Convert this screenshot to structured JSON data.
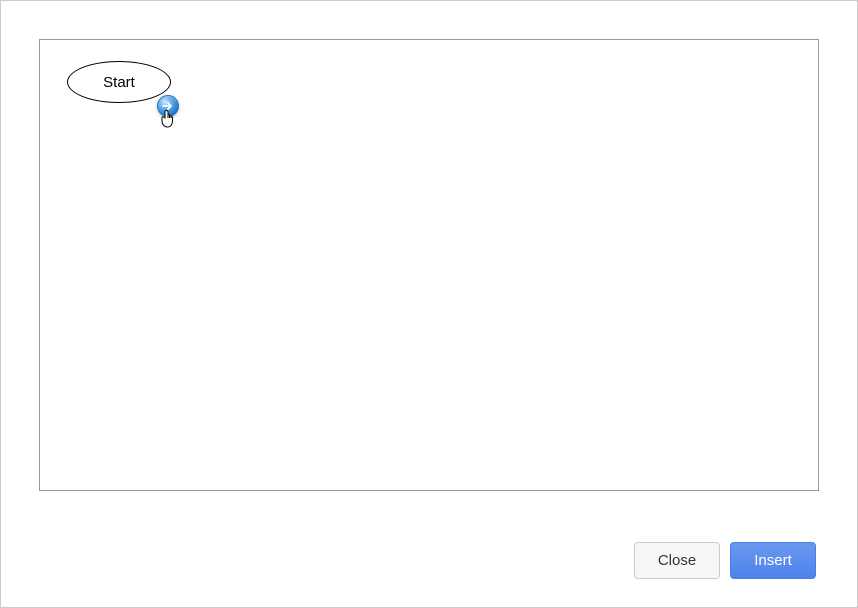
{
  "canvas": {
    "start_label": "Start"
  },
  "buttons": {
    "close": "Close",
    "insert": "Insert"
  }
}
